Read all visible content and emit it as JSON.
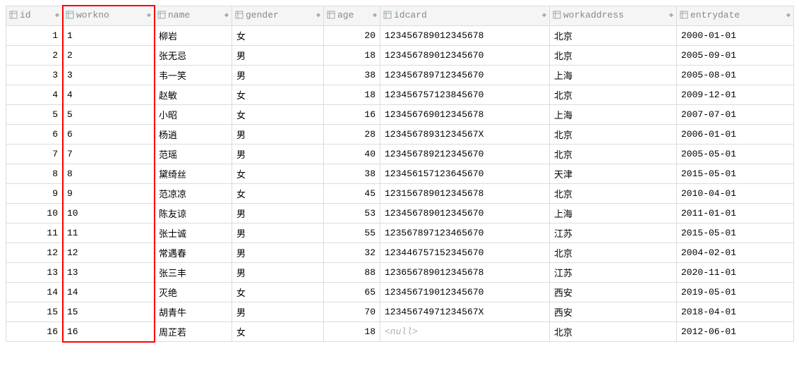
{
  "columns": [
    {
      "key": "id",
      "label": "id",
      "align": "right"
    },
    {
      "key": "workno",
      "label": "workno",
      "align": "left"
    },
    {
      "key": "name",
      "label": "name",
      "align": "left"
    },
    {
      "key": "gender",
      "label": "gender",
      "align": "left"
    },
    {
      "key": "age",
      "label": "age",
      "align": "right"
    },
    {
      "key": "idcard",
      "label": "idcard",
      "align": "left"
    },
    {
      "key": "workaddress",
      "label": "workaddress",
      "align": "left"
    },
    {
      "key": "entrydate",
      "label": "entrydate",
      "align": "left"
    }
  ],
  "highlight_column": "workno",
  "null_display": "<null>",
  "rows": [
    {
      "id": 1,
      "workno": "1",
      "name": "柳岩",
      "gender": "女",
      "age": 20,
      "idcard": "123456789012345678",
      "workaddress": "北京",
      "entrydate": "2000-01-01"
    },
    {
      "id": 2,
      "workno": "2",
      "name": "张无忌",
      "gender": "男",
      "age": 18,
      "idcard": "123456789012345670",
      "workaddress": "北京",
      "entrydate": "2005-09-01"
    },
    {
      "id": 3,
      "workno": "3",
      "name": "韦一笑",
      "gender": "男",
      "age": 38,
      "idcard": "123456789712345670",
      "workaddress": "上海",
      "entrydate": "2005-08-01"
    },
    {
      "id": 4,
      "workno": "4",
      "name": "赵敏",
      "gender": "女",
      "age": 18,
      "idcard": "123456757123845670",
      "workaddress": "北京",
      "entrydate": "2009-12-01"
    },
    {
      "id": 5,
      "workno": "5",
      "name": "小昭",
      "gender": "女",
      "age": 16,
      "idcard": "123456769012345678",
      "workaddress": "上海",
      "entrydate": "2007-07-01"
    },
    {
      "id": 6,
      "workno": "6",
      "name": "杨逍",
      "gender": "男",
      "age": 28,
      "idcard": "12345678931234567X",
      "workaddress": "北京",
      "entrydate": "2006-01-01"
    },
    {
      "id": 7,
      "workno": "7",
      "name": "范瑶",
      "gender": "男",
      "age": 40,
      "idcard": "123456789212345670",
      "workaddress": "北京",
      "entrydate": "2005-05-01"
    },
    {
      "id": 8,
      "workno": "8",
      "name": "黛绮丝",
      "gender": "女",
      "age": 38,
      "idcard": "123456157123645670",
      "workaddress": "天津",
      "entrydate": "2015-05-01"
    },
    {
      "id": 9,
      "workno": "9",
      "name": "范凉凉",
      "gender": "女",
      "age": 45,
      "idcard": "123156789012345678",
      "workaddress": "北京",
      "entrydate": "2010-04-01"
    },
    {
      "id": 10,
      "workno": "10",
      "name": "陈友谅",
      "gender": "男",
      "age": 53,
      "idcard": "123456789012345670",
      "workaddress": "上海",
      "entrydate": "2011-01-01"
    },
    {
      "id": 11,
      "workno": "11",
      "name": "张士诚",
      "gender": "男",
      "age": 55,
      "idcard": "123567897123465670",
      "workaddress": "江苏",
      "entrydate": "2015-05-01"
    },
    {
      "id": 12,
      "workno": "12",
      "name": "常遇春",
      "gender": "男",
      "age": 32,
      "idcard": "123446757152345670",
      "workaddress": "北京",
      "entrydate": "2004-02-01"
    },
    {
      "id": 13,
      "workno": "13",
      "name": "张三丰",
      "gender": "男",
      "age": 88,
      "idcard": "123656789012345678",
      "workaddress": "江苏",
      "entrydate": "2020-11-01"
    },
    {
      "id": 14,
      "workno": "14",
      "name": "灭绝",
      "gender": "女",
      "age": 65,
      "idcard": "123456719012345670",
      "workaddress": "西安",
      "entrydate": "2019-05-01"
    },
    {
      "id": 15,
      "workno": "15",
      "name": "胡青牛",
      "gender": "男",
      "age": 70,
      "idcard": "12345674971234567X",
      "workaddress": "西安",
      "entrydate": "2018-04-01"
    },
    {
      "id": 16,
      "workno": "16",
      "name": "周芷若",
      "gender": "女",
      "age": 18,
      "idcard": null,
      "workaddress": "北京",
      "entrydate": "2012-06-01"
    }
  ]
}
